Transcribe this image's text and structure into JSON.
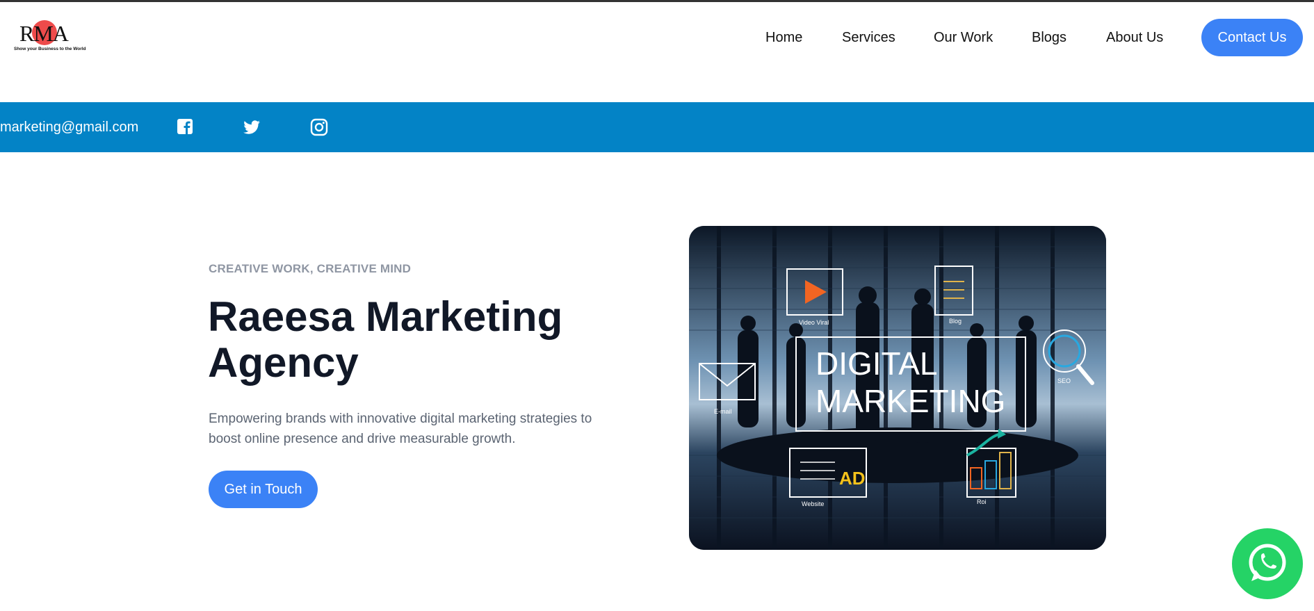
{
  "logo": {
    "letters": "RMA",
    "tagline": "Show your Business to the World"
  },
  "nav": {
    "items": [
      "Home",
      "Services",
      "Our Work",
      "Blogs",
      "About Us"
    ],
    "contact_label": "Contact Us"
  },
  "contact_bar": {
    "email": "marketing@gmail.com",
    "social": [
      "facebook-icon",
      "twitter-icon",
      "instagram-icon"
    ]
  },
  "hero": {
    "eyebrow": "CREATIVE WORK, CREATIVE MIND",
    "title": "Raeesa Marketing Agency",
    "description": "Empowering brands with innovative digital marketing strategies to boost online presence and drive measurable growth.",
    "cta_label": "Get in Touch"
  },
  "hero_image": {
    "headline_line1": "DIGITAL",
    "headline_line2": "MARKETING",
    "labels": [
      "Video Viral",
      "Blog",
      "E-mail",
      "SEO",
      "Website",
      "Roi"
    ],
    "badge": "AD"
  },
  "colors": {
    "accent": "#3b82f6",
    "bar": "#0383c6",
    "whatsapp": "#25d366",
    "heading": "#111827"
  }
}
